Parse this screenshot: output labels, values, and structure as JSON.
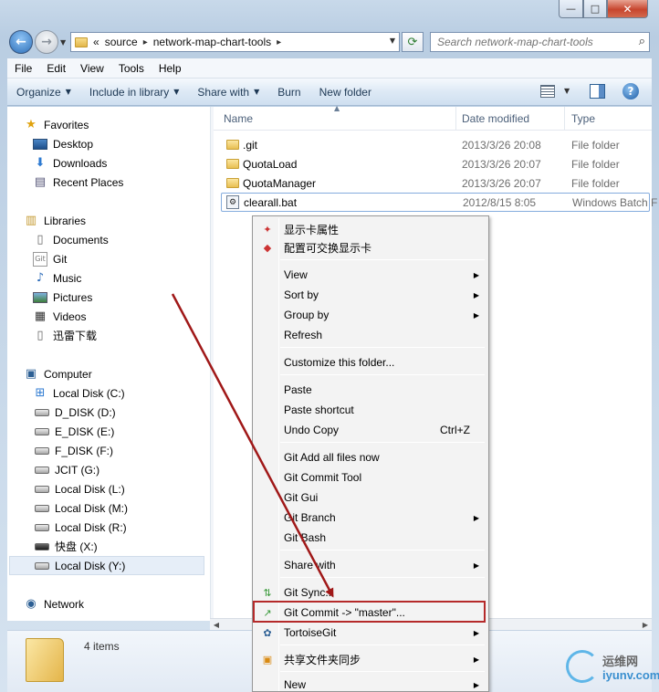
{
  "window": {
    "min_glyph": "—",
    "max_glyph": "□",
    "close_glyph": "✕"
  },
  "address": {
    "chevrons": "«",
    "crumbs": [
      "source",
      "network-map-chart-tools"
    ],
    "search_placeholder": "Search network-map-chart-tools"
  },
  "menubar": [
    "File",
    "Edit",
    "View",
    "Tools",
    "Help"
  ],
  "commands": {
    "organize": "Organize",
    "include": "Include in library",
    "share": "Share with",
    "burn": "Burn",
    "new_folder": "New folder"
  },
  "nav": {
    "favorites": "Favorites",
    "desktop": "Desktop",
    "downloads": "Downloads",
    "recent": "Recent Places",
    "libraries": "Libraries",
    "documents": "Documents",
    "git": "Git",
    "music": "Music",
    "pictures": "Pictures",
    "videos": "Videos",
    "xunlei": "迅雷下载",
    "computer": "Computer",
    "drives": [
      "Local Disk (C:)",
      "D_DISK (D:)",
      "E_DISK (E:)",
      "F_DISK (F:)",
      "JCIT (G:)",
      "Local Disk (L:)",
      "Local Disk (M:)",
      "Local Disk (R:)",
      "快盘 (X:)",
      "Local Disk (Y:)"
    ],
    "network": "Network"
  },
  "columns": {
    "name": "Name",
    "date": "Date modified",
    "type": "Type"
  },
  "files": [
    {
      "name": ".git",
      "date": "2013/3/26 20:08",
      "type": "File folder"
    },
    {
      "name": "QuotaLoad",
      "date": "2013/3/26 20:07",
      "type": "File folder"
    },
    {
      "name": "QuotaManager",
      "date": "2013/3/26 20:07",
      "type": "File folder"
    },
    {
      "name": "clearall.bat",
      "date": "2012/8/15 8:05",
      "type": "Windows Batch F"
    }
  ],
  "details": {
    "count": "4 items"
  },
  "context_menu": {
    "display_props": "显示卡属性",
    "switchable_gpu": "配置可交换显示卡",
    "view": "View",
    "sort_by": "Sort by",
    "group_by": "Group by",
    "refresh": "Refresh",
    "customize": "Customize this folder...",
    "paste": "Paste",
    "paste_shortcut": "Paste shortcut",
    "undo_copy": "Undo Copy",
    "undo_shortcut": "Ctrl+Z",
    "git_add": "Git Add all files now",
    "git_commit_tool": "Git Commit Tool",
    "git_gui": "Git Gui",
    "git_branch": "Git Branch",
    "git_bash": "Git Bash",
    "share_with": "Share with",
    "git_sync": "Git Sync...",
    "git_commit_master": "Git Commit -> \"master\"...",
    "tortoisegit": "TortoiseGit",
    "share_sync": "共享文件夹同步",
    "new": "New"
  },
  "watermark": {
    "cn": "运维网",
    "domain": "iyunv.com"
  },
  "colors": {
    "highlight_box": "#b52a2a",
    "arrow": "#a01818",
    "accent_blue": "#1f5ea6"
  }
}
